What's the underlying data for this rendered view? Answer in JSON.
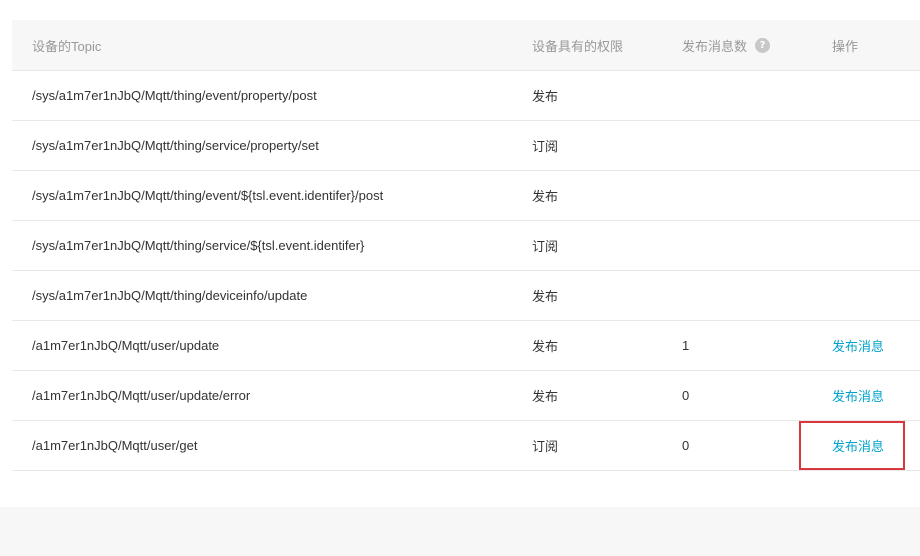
{
  "table": {
    "headers": {
      "topic": "设备的Topic",
      "permission": "设备具有的权限",
      "count": "发布消息数",
      "operation": "操作"
    },
    "rows": [
      {
        "topic": "/sys/a1m7er1nJbQ/Mqtt/thing/event/property/post",
        "permission": "发布",
        "count": "",
        "action": ""
      },
      {
        "topic": "/sys/a1m7er1nJbQ/Mqtt/thing/service/property/set",
        "permission": "订阅",
        "count": "",
        "action": ""
      },
      {
        "topic": "/sys/a1m7er1nJbQ/Mqtt/thing/event/${tsl.event.identifer}/post",
        "permission": "发布",
        "count": "",
        "action": ""
      },
      {
        "topic": "/sys/a1m7er1nJbQ/Mqtt/thing/service/${tsl.event.identifer}",
        "permission": "订阅",
        "count": "",
        "action": ""
      },
      {
        "topic": "/sys/a1m7er1nJbQ/Mqtt/thing/deviceinfo/update",
        "permission": "发布",
        "count": "",
        "action": ""
      },
      {
        "topic": "/a1m7er1nJbQ/Mqtt/user/update",
        "permission": "发布",
        "count": "1",
        "action": "发布消息"
      },
      {
        "topic": "/a1m7er1nJbQ/Mqtt/user/update/error",
        "permission": "发布",
        "count": "0",
        "action": "发布消息"
      },
      {
        "topic": "/a1m7er1nJbQ/Mqtt/user/get",
        "permission": "订阅",
        "count": "0",
        "action": "发布消息"
      }
    ]
  },
  "icons": {
    "count_help": "question-circle-icon"
  },
  "colors": {
    "link": "#00a2ca",
    "highlight": "#d9363e",
    "header_bg": "#f7f7f7",
    "header_text": "#999999"
  }
}
